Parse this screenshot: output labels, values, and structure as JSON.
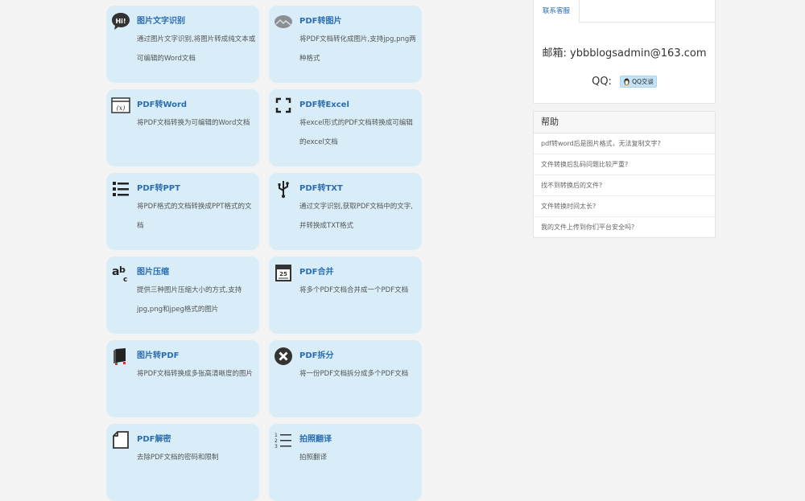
{
  "tools": [
    {
      "title": "图片文字识别",
      "desc": "通过图片文字识别,将图片转成纯文本或可编辑的Word文档",
      "icon": "hi-speech-bubble-icon"
    },
    {
      "title": "PDF转图片",
      "desc": "将PDF文档转化成图片,支持jpg,png两种格式",
      "icon": "picture-oval-icon"
    },
    {
      "title": "PDF转Word",
      "desc": "将PDF文档转换为可编辑的Word文档",
      "icon": "function-window-icon"
    },
    {
      "title": "PDF转Excel",
      "desc": "将excel形式的PDF文档转换成可编辑的excel文档",
      "icon": "convert-arrows-icon"
    },
    {
      "title": "PDF转PPT",
      "desc": "将PDF格式的文档转换成PPT格式的文档",
      "icon": "list-icon"
    },
    {
      "title": "PDF转TXT",
      "desc": "通过文字识别,获取PDF文档中的文字,并转换成TXT格式",
      "icon": "usb-icon"
    },
    {
      "title": "图片压缩",
      "desc": "提供三种图片压缩大小的方式,支持jpg,png和jpeg格式的图片",
      "icon": "abc-icon"
    },
    {
      "title": "PDF合并",
      "desc": "将多个PDF文档合并成一个PDF文档",
      "icon": "calendar-icon"
    },
    {
      "title": "图片转PDF",
      "desc": "将PDF文档转换成多张高清晰度的图片",
      "icon": "book-icon"
    },
    {
      "title": "PDF拆分",
      "desc": "将一份PDF文档拆分成多个PDF文档",
      "icon": "close-circle-icon"
    },
    {
      "title": "PDF解密",
      "desc": "去除PDF文档的密码和限制",
      "icon": "page-corner-icon"
    },
    {
      "title": "拍照翻译",
      "desc": "拍照翻译",
      "icon": "numbered-list-icon"
    }
  ],
  "contact": {
    "tab_label": "联系客服",
    "email": "邮箱: ybbblogsadmin@163.com",
    "qq_label": "QQ:",
    "qq_button": "QQ交谈",
    "qq_icon": "penguin-icon"
  },
  "help": {
    "title": "帮助",
    "items": [
      "pdf转word后是图片格式，无法复制文字?",
      "文件转换后乱码问题比较严重?",
      "找不到转换后的文件?",
      "文件转换时间太长?",
      "我的文件上传到你们平台安全吗?"
    ]
  },
  "colors": {
    "card_bg": "#d9edf8",
    "title": "#2a6db3",
    "page_bg": "#f3f3f3"
  }
}
